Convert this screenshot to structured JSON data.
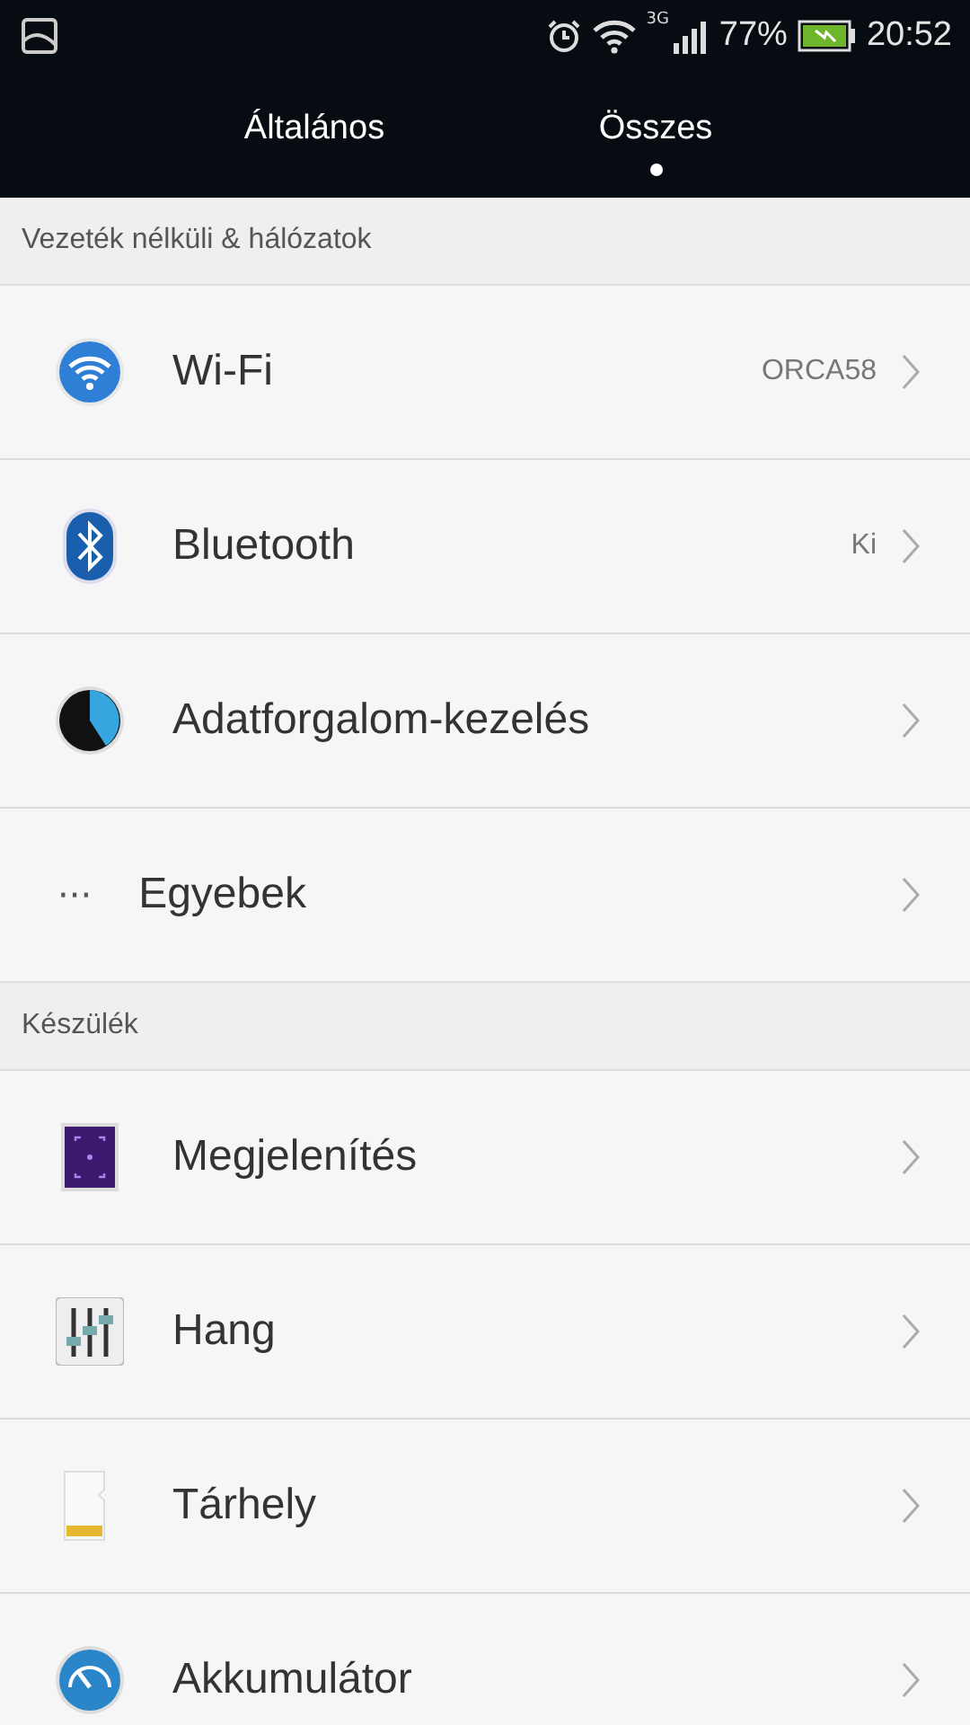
{
  "status_bar": {
    "battery": "77%",
    "time": "20:52",
    "network": "3G"
  },
  "tabs": [
    {
      "label": "Általános",
      "selected": false
    },
    {
      "label": "Összes",
      "selected": true
    }
  ],
  "sections": [
    {
      "title": "Vezeték nélküli & hálózatok",
      "items": [
        {
          "kind": "wifi",
          "label": "Wi-Fi",
          "value": "ORCA58"
        },
        {
          "kind": "bluetooth",
          "label": "Bluetooth",
          "value": "Ki"
        },
        {
          "kind": "data",
          "label": "Adatforgalom-kezelés"
        },
        {
          "kind": "dots",
          "glyph": "···",
          "label": "Egyebek"
        }
      ]
    },
    {
      "title": "Készülék",
      "items": [
        {
          "kind": "display",
          "label": "Megjelenítés"
        },
        {
          "kind": "sound",
          "label": "Hang"
        },
        {
          "kind": "storage",
          "label": "Tárhely"
        },
        {
          "kind": "battery",
          "label": "Akkumulátor"
        }
      ]
    }
  ]
}
